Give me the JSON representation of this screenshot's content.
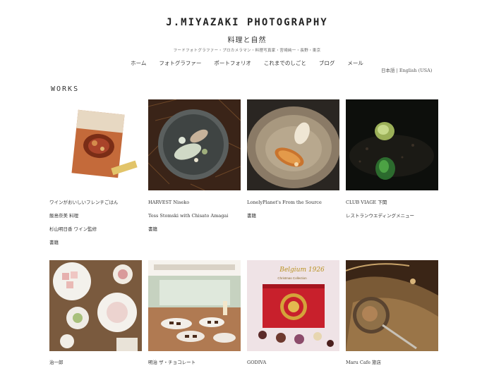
{
  "header": {
    "title": "J.MIYAZAKI PHOTOGRAPHY",
    "subtitle": "料理と自然",
    "tagline": "フードフォトグラファー・プロカメラマン・料理写真家・宮崎純一・長野・東京"
  },
  "nav": {
    "items": [
      "ホーム",
      "フォトグラファー",
      "ポートフォリオ",
      "これまでのしごと",
      "ブログ",
      "メール"
    ]
  },
  "lang": {
    "ja": "日本語",
    "sep": " | ",
    "en": "English (USA)"
  },
  "works": {
    "heading": "WORKS",
    "items": [
      {
        "lines": [
          "ワインがおいしいフレンチごはん",
          "飯島奈美 料理",
          "杉山明日香 ワイン監修"
        ],
        "category": "書籍"
      },
      {
        "lines": [
          "HARVEST Niseko",
          "Tess Stomski with Chisato Amagai"
        ],
        "category": "書籍"
      },
      {
        "lines": [
          "LonelyPlanet's From the Source"
        ],
        "category": "書籍"
      },
      {
        "lines": [
          "CLUB VIAGE 下関",
          "レストランウエディングメニュー"
        ],
        "category": ""
      },
      {
        "lines": [
          "治一郎"
        ],
        "category": ""
      },
      {
        "lines": [
          "明治 ザ・チョコレート"
        ],
        "category": ""
      },
      {
        "lines": [
          "GODIVA"
        ],
        "category": ""
      },
      {
        "lines": [
          "Maru Cafe 旅店"
        ],
        "category": ""
      }
    ]
  },
  "photo_text": {
    "godiva_brand": "Belgium 1926",
    "godiva_collection": "Christmas Collection"
  }
}
